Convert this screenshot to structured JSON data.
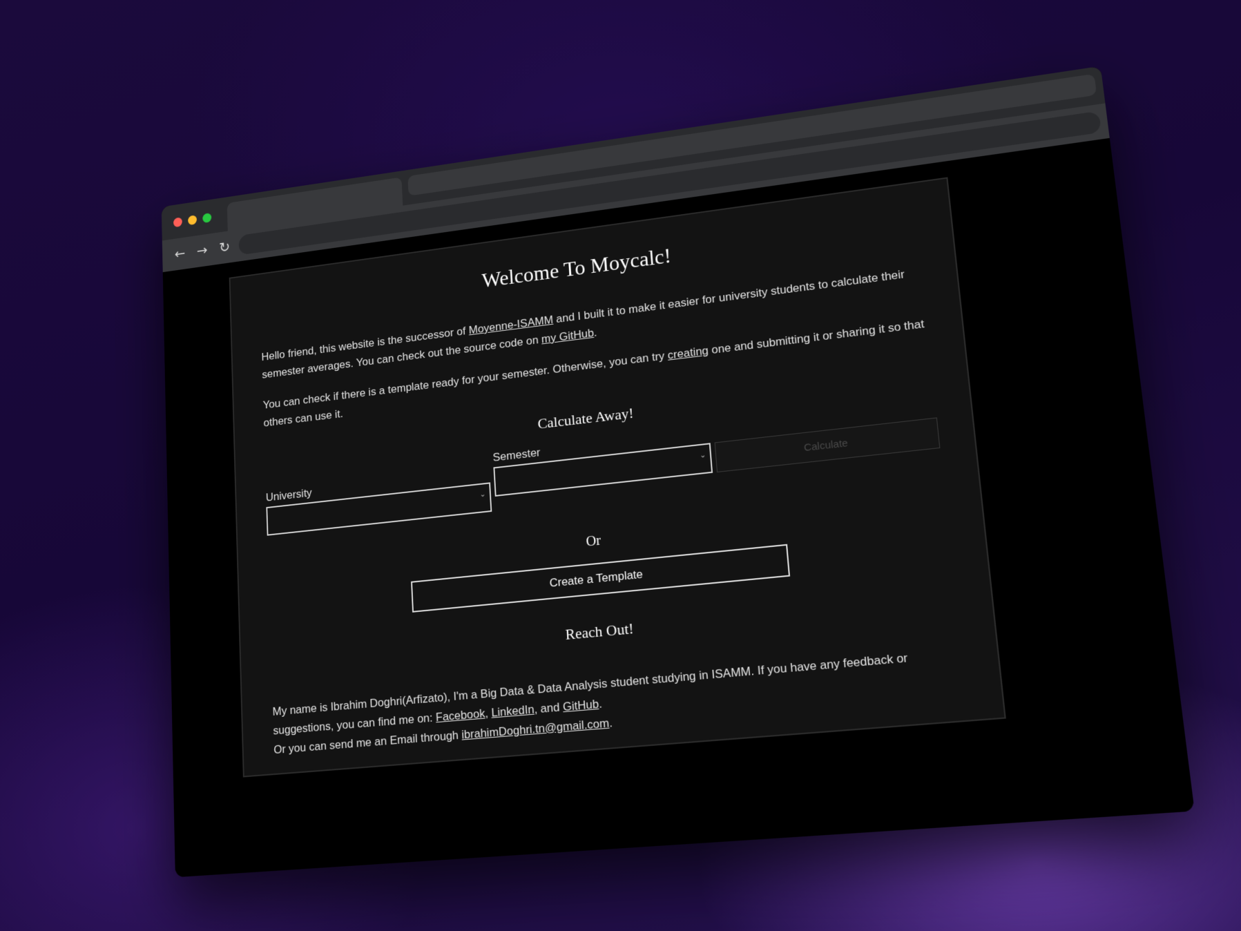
{
  "browser": {
    "traffic_colors": {
      "close": "#ff5f57",
      "minimize": "#febc2e",
      "maximize": "#28c840"
    },
    "nav": {
      "back_icon": "←",
      "forward_icon": "→",
      "reload_icon": "↻"
    }
  },
  "page": {
    "title": "Welcome To Moycalc!",
    "intro1": {
      "pre": "Hello friend, this website is the successor of ",
      "link1": "Moyenne-ISAMM",
      "mid": " and I built it to make it easier for university students to calculate their semester averages. You can check out the source code on ",
      "link2": "my GitHub",
      "post": "."
    },
    "intro2": {
      "pre": "You can check if there is a template ready for your semester. Otherwise, you can try ",
      "link": "creating",
      "post": " one and submitting it or sharing it so that others can use it."
    },
    "calc_heading": "Calculate Away!",
    "form": {
      "university_label": "University",
      "semester_label": "Semester",
      "calculate_label": "Calculate"
    },
    "or_text": "Or",
    "create_template_label": "Create a Template",
    "reach_heading": "Reach Out!",
    "about": {
      "line1": "My name is Ibrahim Doghri(Arfizato), I'm a Big Data & Data Analysis student studying in ISAMM. If you have any feedback or suggestions, you can find me on: ",
      "facebook": "Facebook",
      "sep1": ", ",
      "linkedin": "LinkedIn",
      "sep2": ", and ",
      "github": "GitHub",
      "end1": ".",
      "line2": "Or you can send me an Email through ",
      "email": "ibrahimDoghri.tn@gmail.com",
      "end2": "."
    }
  }
}
